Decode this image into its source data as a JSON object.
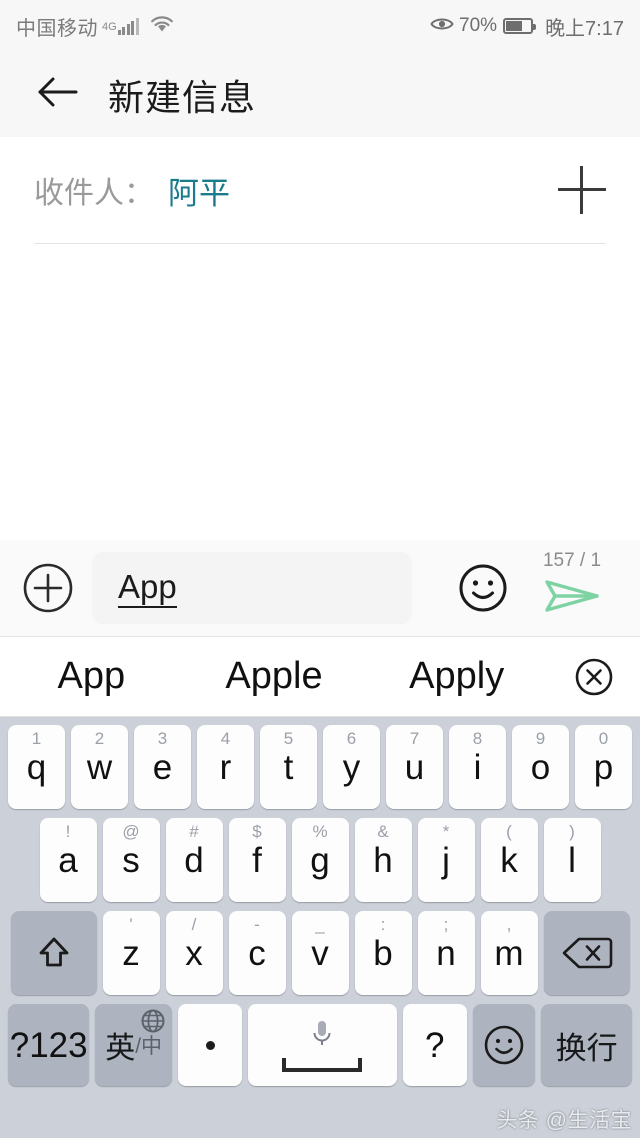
{
  "status_bar": {
    "carrier": "中国移动",
    "network": "4G",
    "wifi_icon": "wifi-icon",
    "eye_icon": "eye-comfort-icon",
    "battery_percent": "70%",
    "time": "晚上7:17"
  },
  "header": {
    "back_icon": "back-arrow-icon",
    "title": "新建信息"
  },
  "recipient": {
    "label": "收件人：",
    "value": "阿平",
    "add_icon": "plus-icon"
  },
  "input_bar": {
    "attach_icon": "plus-circle-icon",
    "composing_text": "App",
    "placeholder": "",
    "emoji_icon": "smiley-icon",
    "counter": "157 / 1",
    "send_icon": "send-icon"
  },
  "suggestions": {
    "items": [
      "App",
      "Apple",
      "Apply"
    ],
    "close_icon": "close-circle-icon"
  },
  "keyboard": {
    "row1": [
      {
        "main": "q",
        "sup": "1"
      },
      {
        "main": "w",
        "sup": "2"
      },
      {
        "main": "e",
        "sup": "3"
      },
      {
        "main": "r",
        "sup": "4"
      },
      {
        "main": "t",
        "sup": "5"
      },
      {
        "main": "y",
        "sup": "6"
      },
      {
        "main": "u",
        "sup": "7"
      },
      {
        "main": "i",
        "sup": "8"
      },
      {
        "main": "o",
        "sup": "9"
      },
      {
        "main": "p",
        "sup": "0"
      }
    ],
    "row2": [
      {
        "main": "a",
        "sup": "!"
      },
      {
        "main": "s",
        "sup": "@"
      },
      {
        "main": "d",
        "sup": "#"
      },
      {
        "main": "f",
        "sup": "$"
      },
      {
        "main": "g",
        "sup": "%"
      },
      {
        "main": "h",
        "sup": "&"
      },
      {
        "main": "j",
        "sup": "*"
      },
      {
        "main": "k",
        "sup": "("
      },
      {
        "main": "l",
        "sup": ")"
      }
    ],
    "row3": [
      {
        "main": "z",
        "sup": "'"
      },
      {
        "main": "x",
        "sup": "/"
      },
      {
        "main": "c",
        "sup": "-"
      },
      {
        "main": "v",
        "sup": "_"
      },
      {
        "main": "b",
        "sup": ":"
      },
      {
        "main": "n",
        "sup": ";"
      },
      {
        "main": "m",
        "sup": ","
      }
    ],
    "shift_icon": "shift-icon",
    "backspace_icon": "backspace-icon",
    "symbols_key": "?123",
    "lang_key_main": "英",
    "lang_key_sub": "/中",
    "globe_icon": "globe-icon",
    "period_key": ".",
    "space_key_icon": "microphone-icon",
    "question_key": "?",
    "emoji_key_icon": "smiley-icon",
    "enter_key": "换行"
  },
  "watermark": "头条 @生活宝",
  "colors": {
    "accent_teal": "#1a7b8c",
    "send_green": "#7fd3a3",
    "keyboard_bg": "#ccd1d9",
    "key_dark": "#aeb4bf"
  }
}
